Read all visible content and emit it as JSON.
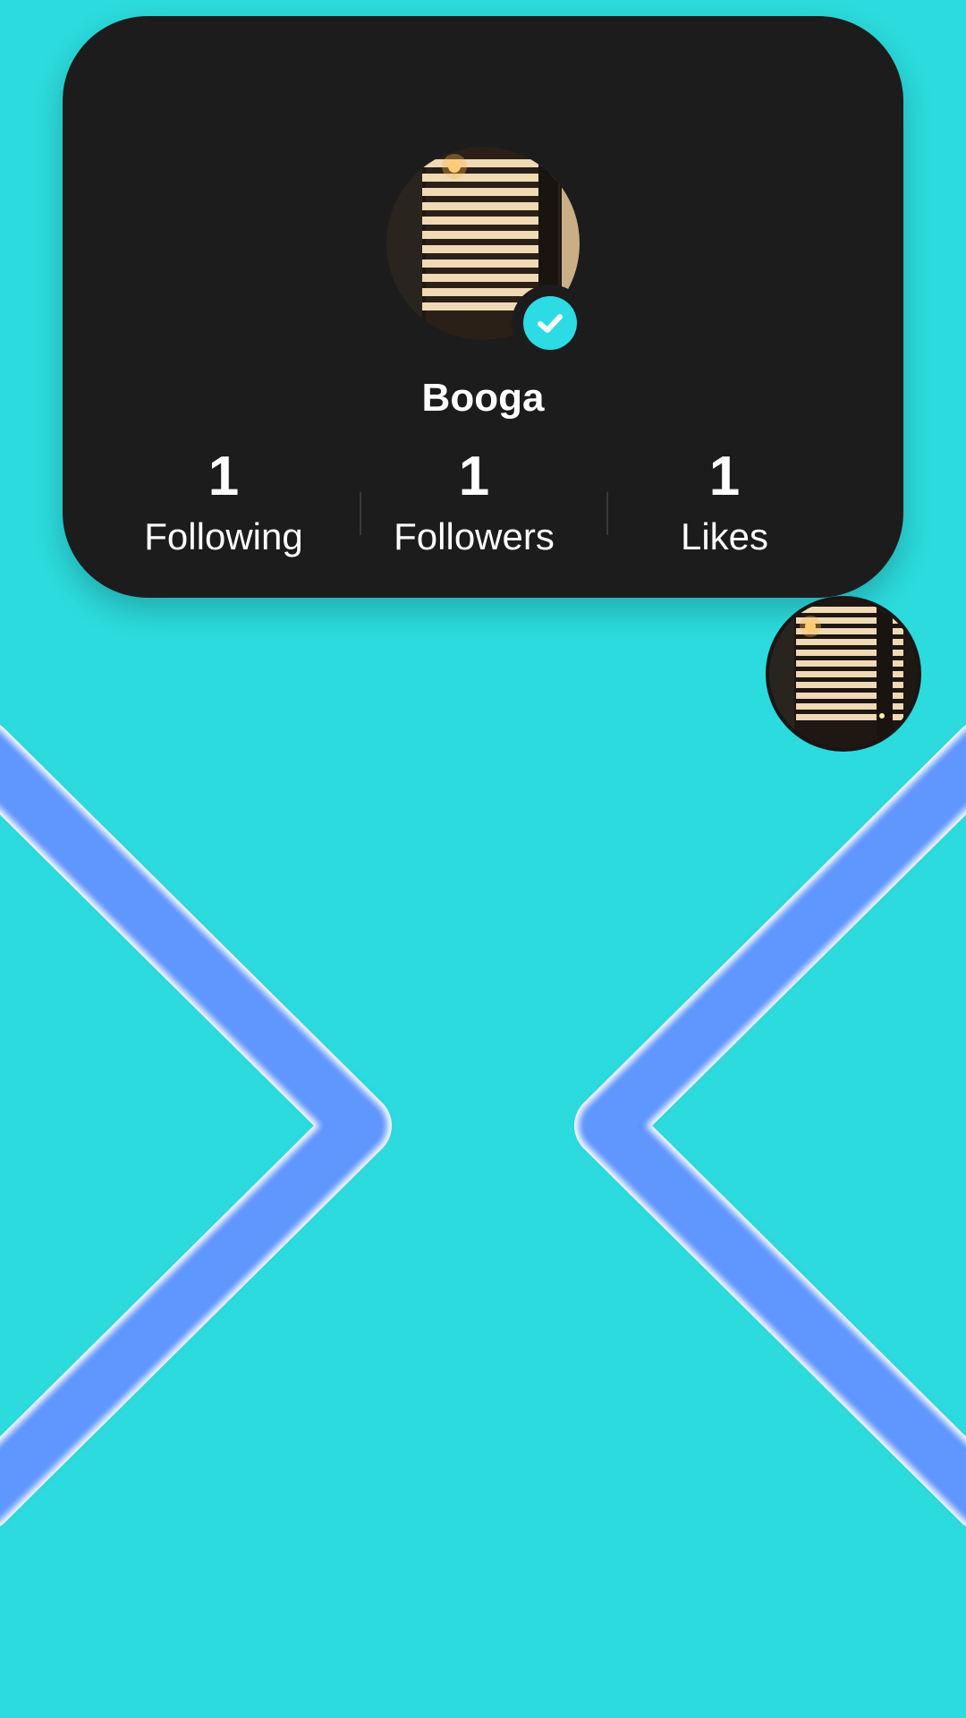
{
  "profile": {
    "username": "Booga",
    "verified": true,
    "stats": [
      {
        "value": "1",
        "label": "Following"
      },
      {
        "value": "1",
        "label": "Followers"
      },
      {
        "value": "1",
        "label": "Likes"
      }
    ]
  },
  "icons": {
    "verified": "check-circle-icon"
  },
  "colors": {
    "background": "#2cdbdd",
    "card": "#1c1c1d",
    "accent": "#2cdbe4",
    "chevron": "#5b93ff"
  }
}
